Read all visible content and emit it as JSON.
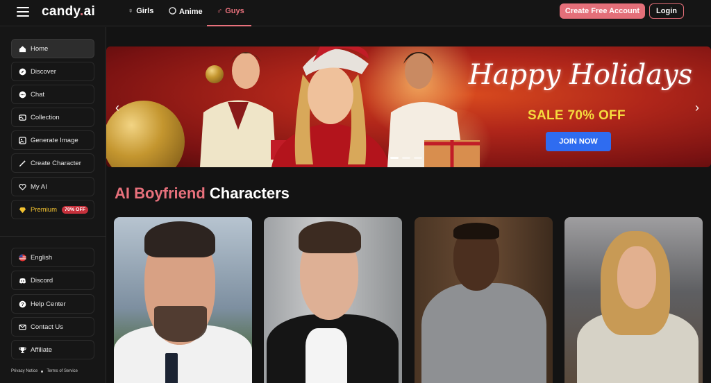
{
  "app": {
    "logo_main": "candy",
    "logo_dot": ".",
    "logo_tld": "ai"
  },
  "nav": {
    "tabs": [
      {
        "label": "Girls",
        "icon": "female-icon"
      },
      {
        "label": "Anime",
        "icon": "anime-icon"
      },
      {
        "label": "Guys",
        "icon": "male-icon",
        "active": true
      }
    ]
  },
  "header": {
    "create_account": "Create Free Account",
    "login": "Login"
  },
  "sidebar": {
    "items": [
      {
        "label": "Home",
        "icon": "home-icon"
      },
      {
        "label": "Discover",
        "icon": "compass-icon"
      },
      {
        "label": "Chat",
        "icon": "chat-icon"
      },
      {
        "label": "Collection",
        "icon": "collection-icon"
      },
      {
        "label": "Generate Image",
        "icon": "image-icon"
      },
      {
        "label": "Create Character",
        "icon": "magic-wand-icon"
      },
      {
        "label": "My AI",
        "icon": "heart-icon"
      },
      {
        "label": "Premium",
        "icon": "diamond-icon",
        "badge": "70% OFF"
      }
    ],
    "bottom_items": [
      {
        "label": "English",
        "icon": "us-flag-icon"
      },
      {
        "label": "Discord",
        "icon": "discord-icon"
      },
      {
        "label": "Help Center",
        "icon": "help-icon"
      },
      {
        "label": "Contact Us",
        "icon": "mail-icon"
      },
      {
        "label": "Affiliate",
        "icon": "trophy-icon"
      }
    ],
    "footer": {
      "privacy": "Privacy Notice",
      "terms": "Terms of Service"
    }
  },
  "banner": {
    "title": "Happy Holidays",
    "sale": "SALE 70% OFF",
    "cta": "JOIN NOW",
    "slide_count": 3,
    "active_slide": 1
  },
  "section": {
    "title_accent": "AI Boyfriend",
    "title_rest": " Characters"
  },
  "colors": {
    "accent": "#e8717c",
    "premium": "#f2c230",
    "cta": "#2f6cf0",
    "sale": "#f5dc3e"
  }
}
